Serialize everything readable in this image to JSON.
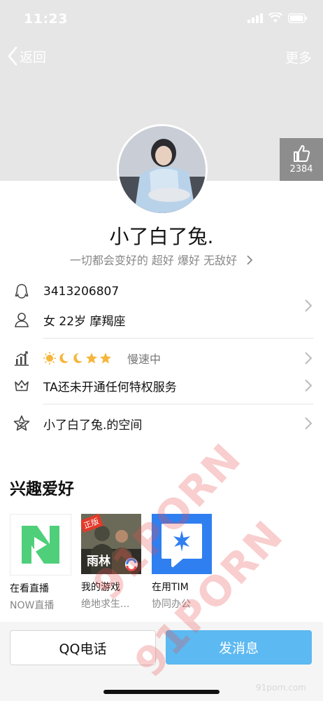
{
  "status_bar": {
    "time": "11:23"
  },
  "nav": {
    "back_label": "返回",
    "more_label": "更多"
  },
  "like": {
    "count": "2384"
  },
  "profile": {
    "nickname": "小了白了兔.",
    "signature": "一切都会变好的 超好 爆好 无敌好"
  },
  "info": {
    "qq_number": "3413206807",
    "details": "女 22岁 摩羯座",
    "level_status": "慢速中",
    "privilege": "TA还未开通任何特权服务",
    "space": "小了白了兔.的空间"
  },
  "interests": {
    "title": "兴趣爱好",
    "apps": [
      {
        "name": "在看直播",
        "sub": "NOW直播",
        "icon": "now-live-icon"
      },
      {
        "name": "我的游戏",
        "sub": "绝地求生...",
        "icon": "pubg-game-icon",
        "badge": "正版",
        "art_text": "雨林"
      },
      {
        "name": "在用TIM",
        "sub": "协同办公",
        "icon": "tim-icon"
      }
    ]
  },
  "actions": {
    "call_label": "QQ电话",
    "message_label": "发消息"
  },
  "watermarks": {
    "text1": "91PORN",
    "text2": "91PORN",
    "text3": "91porn.com"
  },
  "colors": {
    "accent": "#5cb9f1",
    "header_bg": "#e6e6e6",
    "now_green": "#4fcf7a",
    "tim_blue": "#2f7ff0"
  }
}
